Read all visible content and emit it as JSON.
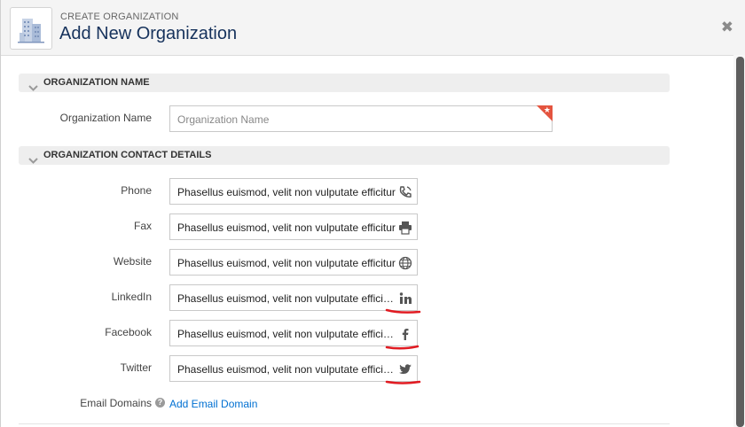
{
  "header": {
    "eyebrow": "CREATE ORGANIZATION",
    "title": "Add New Organization",
    "close_glyph": "✖"
  },
  "sections": {
    "name": {
      "title": "ORGANIZATION NAME",
      "field_label": "Organization Name",
      "field_placeholder": "Organization Name",
      "required_glyph": "★"
    },
    "contact": {
      "title": "ORGANIZATION CONTACT DETAILS",
      "fields": [
        {
          "label": "Phone",
          "value": "Phasellus euismod, velit non vulputate efficitur",
          "icon": "phone-icon"
        },
        {
          "label": "Fax",
          "value": "Phasellus euismod, velit non vulputate efficitur",
          "icon": "printer-icon"
        },
        {
          "label": "Website",
          "value": "Phasellus euismod, velit non vulputate efficitur",
          "icon": "globe-icon"
        },
        {
          "label": "LinkedIn",
          "value": "Phasellus euismod, velit non vulputate efficitur,",
          "icon": "linkedin-icon"
        },
        {
          "label": "Facebook",
          "value": "Phasellus euismod, velit non vulputate efficitur,",
          "icon": "facebook-icon"
        },
        {
          "label": "Twitter",
          "value": "Phasellus euismod, velit non vulputate efficitur,",
          "icon": "twitter-icon"
        }
      ],
      "email_domains_label": "Email Domains",
      "help_glyph": "?",
      "add_email_domain": "Add Email Domain"
    }
  },
  "colors": {
    "title": "#16325c",
    "link": "#0070d2",
    "required_flag": "#e4543f",
    "annotation": "#e11b22"
  }
}
